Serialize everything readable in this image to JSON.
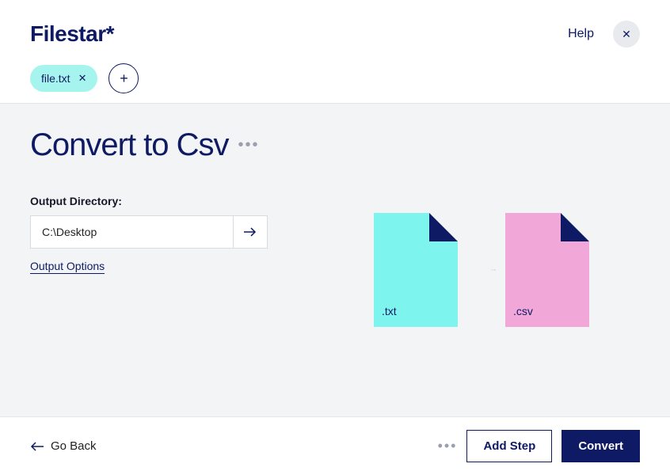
{
  "header": {
    "logo": "Filestar*",
    "help_label": "Help",
    "file_chip": {
      "name": "file.txt"
    }
  },
  "main": {
    "title": "Convert to Csv",
    "output_dir_label": "Output Directory:",
    "output_dir_value": "C:\\Desktop",
    "output_options_label": "Output Options",
    "diagram": {
      "from_ext": ".txt",
      "to_ext": ".csv"
    }
  },
  "footer": {
    "go_back_label": "Go Back",
    "add_step_label": "Add Step",
    "convert_label": "Convert"
  }
}
